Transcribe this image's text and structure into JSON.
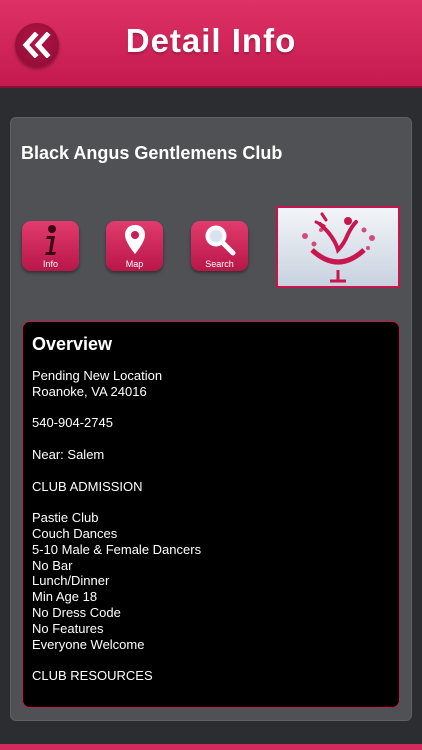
{
  "header": {
    "title": "Detail Info",
    "back_icon": "double-chevron-left-icon"
  },
  "club": {
    "name": "Black Angus Gentlemens Club"
  },
  "actions": [
    {
      "label": "Info",
      "icon": "info-icon"
    },
    {
      "label": "Map",
      "icon": "map-pin-icon"
    },
    {
      "label": "Search",
      "icon": "magnifier-icon"
    }
  ],
  "logo": {
    "icon": "dancer-in-glass-logo"
  },
  "overview": {
    "title": "Overview",
    "lines": [
      "Pending New Location",
      "Roanoke, VA 24016",
      "",
      "540-904-2745",
      "",
      "Near: Salem",
      "",
      "CLUB ADMISSION",
      "",
      "Pastie Club",
      "Couch Dances",
      "5-10 Male & Female Dancers",
      "No Bar",
      "Lunch/Dinner",
      "Min Age 18",
      "No Dress Code",
      "No Features",
      "Everyone Welcome",
      "",
      "CLUB RESOURCES"
    ]
  },
  "colors": {
    "accent": "#d62a5d",
    "background": "#2c2d31",
    "panel": "#505155"
  }
}
